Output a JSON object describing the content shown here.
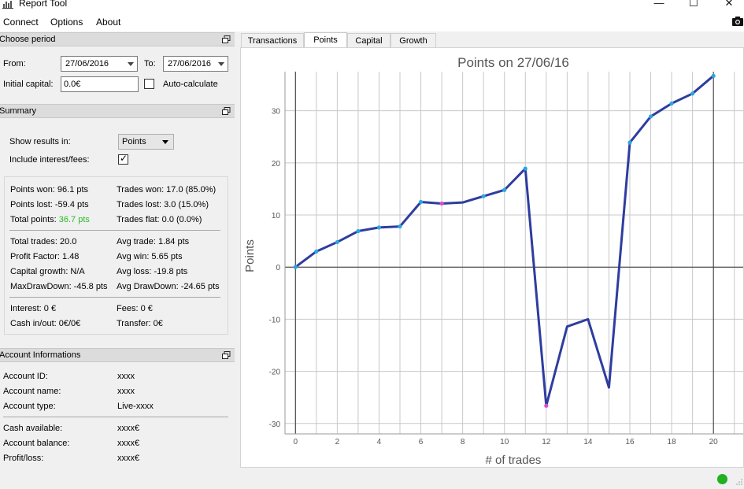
{
  "window": {
    "title": "Report Tool",
    "icon": "bar-chart-icon"
  },
  "menu": {
    "connect": "Connect",
    "options": "Options",
    "about": "About"
  },
  "period": {
    "header": "Choose period",
    "from_label": "From:",
    "from_value": "27/06/2016",
    "to_label": "To:",
    "to_value": "27/06/2016",
    "capital_label": "Initial capital:",
    "capital_value": "0.0€",
    "auto_label": "Auto-calculate",
    "auto_checked": false
  },
  "summary": {
    "header": "Summary",
    "show_label": "Show results in:",
    "show_value": "Points",
    "interest_label": "Include interest/fees:",
    "interest_checked": true,
    "points_won": "Points won: 96.1 pts",
    "points_lost": "Points lost: -59.4 pts",
    "total_points_label": "Total points:",
    "total_points_value": "36.7 pts",
    "trades_won": "Trades won: 17.0 (85.0%)",
    "trades_lost": "Trades lost: 3.0 (15.0%)",
    "trades_flat": "Trades flat: 0.0 (0.0%)",
    "total_trades": "Total trades: 20.0",
    "profit_factor": "Profit Factor: 1.48",
    "capital_growth": "Capital growth: N/A",
    "max_drawdown": "MaxDrawDown: -45.8 pts",
    "avg_trade": "Avg trade: 1.84 pts",
    "avg_win": "Avg win: 5.65 pts",
    "avg_loss": "Avg loss: -19.8 pts",
    "avg_drawdown": "Avg DrawDown: -24.65 pts",
    "interest": "Interest: 0 €",
    "fees": "Fees: 0 €",
    "cash_inout": "Cash in/out: 0€/0€",
    "transfer": "Transfer: 0€"
  },
  "account": {
    "header": "Account Informations",
    "id_label": "Account ID:",
    "id_value": "xxxx",
    "name_label": "Account name:",
    "name_value": "xxxx",
    "type_label": "Account type:",
    "type_value": "Live-xxxx",
    "cash_label": "Cash available:",
    "cash_value": "xxxx€",
    "balance_label": "Account balance:",
    "balance_value": "xxxx€",
    "pl_label": "Profit/loss:",
    "pl_value": "xxxx€"
  },
  "tabs": [
    "Transactions",
    "Points",
    "Capital",
    "Growth"
  ],
  "active_tab": "Points",
  "colors": {
    "line": "#2e3d9e",
    "point": "#2aa7e0",
    "point_loss": "#e04ad0",
    "status_ok": "#20b020",
    "total_green": "#2ab92a"
  },
  "chart_data": {
    "type": "line",
    "title": "Points on 27/06/16",
    "xlabel": "# of trades",
    "ylabel": "Points",
    "xlim": [
      -0.5,
      21.5
    ],
    "ylim": [
      -32,
      37.5
    ],
    "xticks": [
      0,
      2,
      4,
      6,
      8,
      10,
      12,
      14,
      16,
      18,
      20
    ],
    "yticks": [
      -30,
      -20,
      -10,
      0,
      10,
      20,
      30
    ],
    "grid": true,
    "x": [
      0,
      1,
      2,
      3,
      4,
      5,
      6,
      7,
      8,
      9,
      10,
      11,
      12,
      13,
      14,
      15,
      16,
      17,
      18,
      19,
      20
    ],
    "values": [
      0,
      3.0,
      4.8,
      6.9,
      7.6,
      7.8,
      12.5,
      12.2,
      12.4,
      13.6,
      14.8,
      18.9,
      -26.6,
      -11.4,
      -10.0,
      -23.1,
      23.9,
      28.9,
      31.4,
      33.3,
      36.7
    ],
    "markers": [
      {
        "x": 0,
        "kind": "win"
      },
      {
        "x": 1,
        "kind": "win"
      },
      {
        "x": 2,
        "kind": "win"
      },
      {
        "x": 3,
        "kind": "win"
      },
      {
        "x": 4,
        "kind": "win"
      },
      {
        "x": 5,
        "kind": "win"
      },
      {
        "x": 6,
        "kind": "win"
      },
      {
        "x": 7,
        "kind": "loss"
      },
      {
        "x": 9,
        "kind": "win"
      },
      {
        "x": 10,
        "kind": "win"
      },
      {
        "x": 11,
        "kind": "win"
      },
      {
        "x": 12,
        "kind": "loss"
      },
      {
        "x": 16,
        "kind": "win"
      },
      {
        "x": 17,
        "kind": "win"
      },
      {
        "x": 18,
        "kind": "win"
      },
      {
        "x": 19,
        "kind": "win"
      },
      {
        "x": 20,
        "kind": "win"
      }
    ]
  }
}
